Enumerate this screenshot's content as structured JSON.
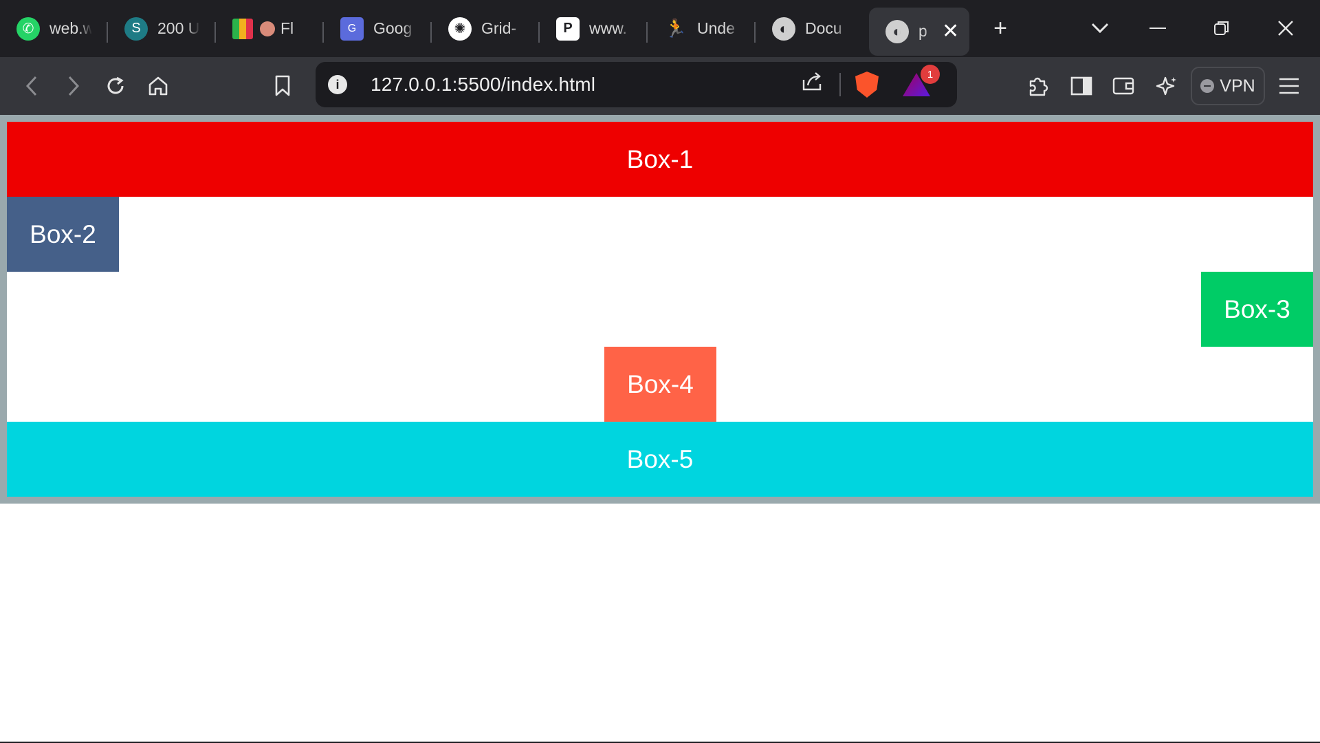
{
  "browser": {
    "tabs": [
      {
        "label": "web.w",
        "icon": "whatsapp-icon",
        "color": "#25d366"
      },
      {
        "label": "200 U",
        "icon": "scribd-icon",
        "color": "#1e7b85"
      },
      {
        "label": "Fl",
        "icon": "palette-icon",
        "color": "#e04a7a"
      },
      {
        "label": "Goog",
        "icon": "google-translate-icon",
        "color": "#5b6bdc"
      },
      {
        "label": "Grid-",
        "icon": "openai-icon",
        "color": "#ffffff"
      },
      {
        "label": "www.",
        "icon": "pi-icon",
        "color": "#ffffff"
      },
      {
        "label": "Unde",
        "icon": "runner-icon",
        "color": "#b01b1b"
      },
      {
        "label": "Docu",
        "icon": "globe-icon",
        "color": "#cfcfcf"
      }
    ],
    "active_tab": {
      "label": "p",
      "icon": "globe-icon"
    },
    "new_tab_symbol": "+",
    "address": "127.0.0.1:5500/index.html",
    "rewards_badge": "1",
    "vpn_label": "VPN"
  },
  "page": {
    "boxes": [
      {
        "label": "Box-1",
        "color": "#ee0000"
      },
      {
        "label": "Box-2",
        "color": "#456089"
      },
      {
        "label": "Box-3",
        "color": "#00cc66"
      },
      {
        "label": "Box-4",
        "color": "#ff6347"
      },
      {
        "label": "Box-5",
        "color": "#00d5df"
      }
    ]
  }
}
